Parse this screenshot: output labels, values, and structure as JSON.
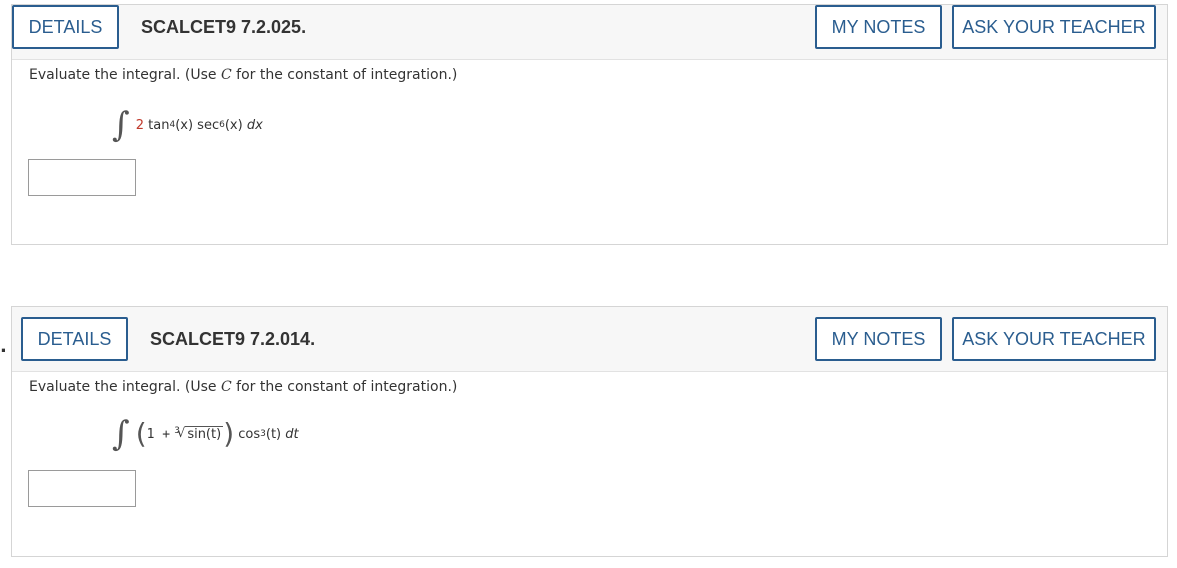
{
  "questions": [
    {
      "details_label": "DETAILS",
      "code": "SCALCET9 7.2.025.",
      "my_notes_label": "MY NOTES",
      "ask_teacher_label": "ASK YOUR TEACHER",
      "prompt_before": "Evaluate the integral. (Use ",
      "prompt_var": "C",
      "prompt_after": " for the constant of integration.)",
      "expr": {
        "coef": "2",
        "f1": "tan",
        "p1": "4",
        "arg1": "(x)",
        "f2": "sec",
        "p2": "6",
        "arg2": "(x)",
        "diff": "dx"
      }
    },
    {
      "details_label": "DETAILS",
      "code": "SCALCET9 7.2.014.",
      "my_notes_label": "MY NOTES",
      "ask_teacher_label": "ASK YOUR TEACHER",
      "prompt_before": "Evaluate the integral. (Use ",
      "prompt_var": "C",
      "prompt_after": " for the constant of integration.)",
      "expr": {
        "one_plus": "1 +",
        "root_index": "3",
        "radicand": "sin(t)",
        "f2": "cos",
        "p2": "3",
        "arg2": "(t)",
        "diff": "dt"
      }
    }
  ],
  "bullet": "."
}
